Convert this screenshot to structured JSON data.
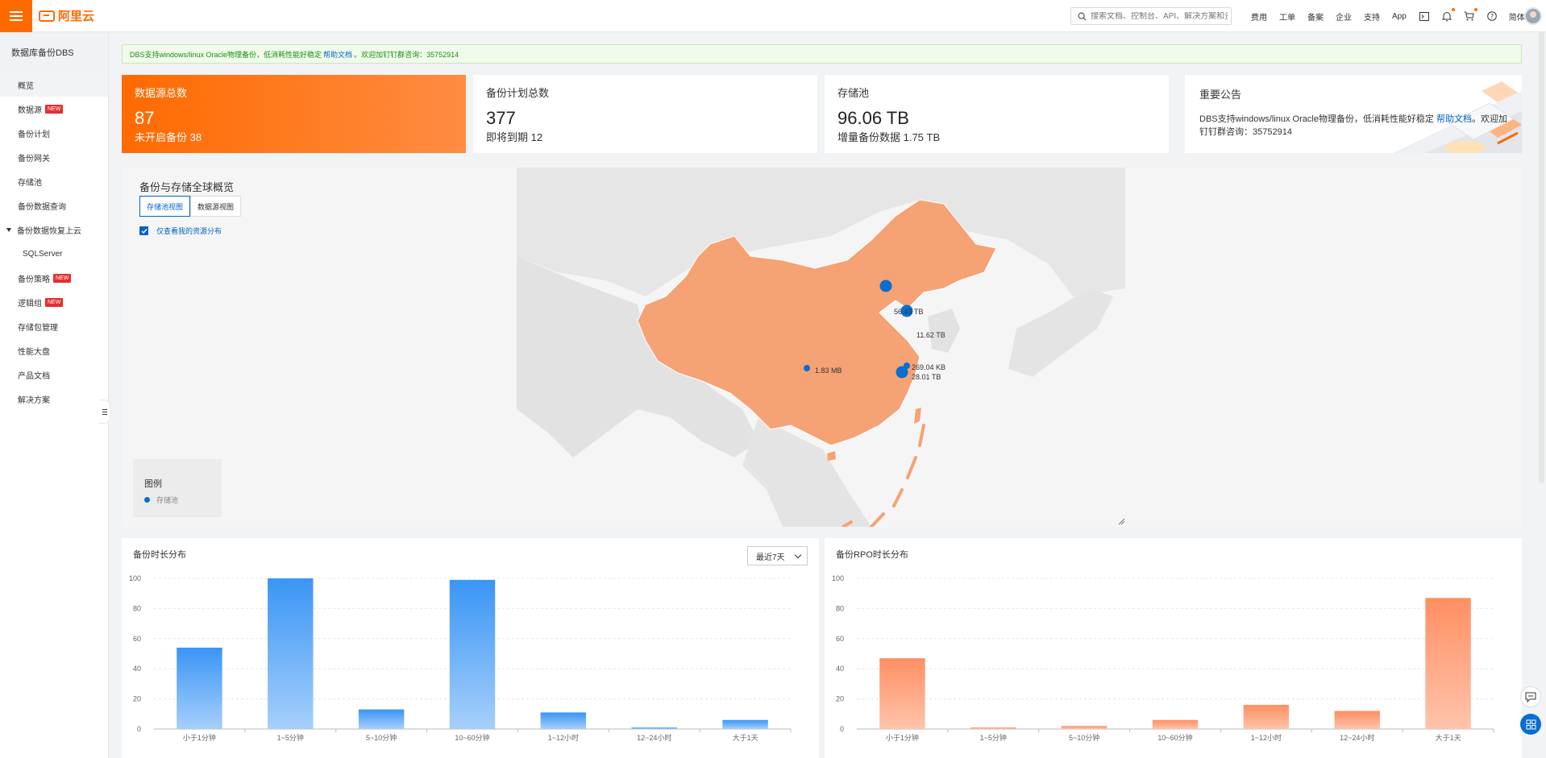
{
  "header": {
    "logo_text": "阿里云",
    "search_placeholder": "搜索文档、控制台、API、解决方案和资",
    "nav_items": [
      "费用",
      "工单",
      "备案",
      "企业",
      "支持",
      "App"
    ],
    "lang": "简体"
  },
  "sidebar": {
    "title": "数据库备份DBS",
    "items": [
      {
        "label": "概览",
        "badge": ""
      },
      {
        "label": "数据源",
        "badge": "NEW"
      },
      {
        "label": "备份计划",
        "badge": ""
      },
      {
        "label": "备份网关",
        "badge": ""
      },
      {
        "label": "存储池",
        "badge": ""
      },
      {
        "label": "备份数据查询",
        "badge": ""
      },
      {
        "label": "备份数据恢复上云",
        "badge": ""
      },
      {
        "label": "SQLServer",
        "badge": ""
      },
      {
        "label": "备份策略",
        "badge": "NEW"
      },
      {
        "label": "逻辑组",
        "badge": "NEW"
      },
      {
        "label": "存储包管理",
        "badge": ""
      },
      {
        "label": "性能大盘",
        "badge": ""
      },
      {
        "label": "产品文档",
        "badge": ""
      },
      {
        "label": "解决方案",
        "badge": ""
      }
    ]
  },
  "notice": {
    "text": "DBS支持windows/linux Oracle物理备份，低消耗性能好稳定",
    "link": "帮助文档",
    "tail": "。欢迎加钉钉群咨询：35752914"
  },
  "stats": {
    "source": {
      "label": "数据源总数",
      "value": "87",
      "sub": "未开启备份 38"
    },
    "plan": {
      "label": "备份计划总数",
      "value": "377",
      "sub": "即将到期 12"
    },
    "pool": {
      "label": "存储池",
      "value": "96.06 TB",
      "sub": "增量备份数据 1.75 TB"
    }
  },
  "announcement": {
    "label": "重要公告",
    "text": "DBS支持windows/linux Oracle物理备份，低消耗性能好稳定",
    "link": "帮助文档",
    "tail": "。欢迎加钉钉群咨询：35752914"
  },
  "map": {
    "title": "备份与存储全球概览",
    "tabs": [
      "存储池视图",
      "数据源视图"
    ],
    "checkbox_label": "仅查看我的资源分布",
    "legend_title": "图例",
    "legend_item": "存储池",
    "points": [
      {
        "label": "56.43 TB"
      },
      {
        "label": "11.62 TB"
      },
      {
        "label": "1.83 MB"
      },
      {
        "label": "269.04 KB"
      },
      {
        "label": "28.01 TB"
      }
    ],
    "colors": {
      "china": "#f5a274",
      "land": "#e8e8e8",
      "marker": "#0a6ed1"
    }
  },
  "charts": {
    "duration": {
      "title": "备份时长分布",
      "select": "最近7天",
      "color": "#3a95f5"
    },
    "rpo": {
      "title": "备份RPO时长分布",
      "color": "#ff8f63"
    }
  },
  "chart_data": [
    {
      "type": "bar",
      "title": "备份时长分布",
      "categories": [
        "小于1分钟",
        "1~5分钟",
        "5~10分钟",
        "10~60分钟",
        "1~12小时",
        "12~24小时",
        "大于1天"
      ],
      "values": [
        54,
        100,
        13,
        99,
        11,
        1,
        6
      ],
      "ylim": [
        0,
        100
      ],
      "yticks": [
        0,
        20,
        40,
        60,
        80,
        100
      ],
      "grid": true
    },
    {
      "type": "bar",
      "title": "备份RPO时长分布",
      "categories": [
        "小于1分钟",
        "1~5分钟",
        "5~10分钟",
        "10~60分钟",
        "1~12小时",
        "12~24小时",
        "大于1天"
      ],
      "values": [
        47,
        1,
        2,
        6,
        16,
        12,
        87
      ],
      "ylim": [
        0,
        100
      ],
      "yticks": [
        0,
        20,
        40,
        60,
        80,
        100
      ],
      "grid": true
    }
  ]
}
